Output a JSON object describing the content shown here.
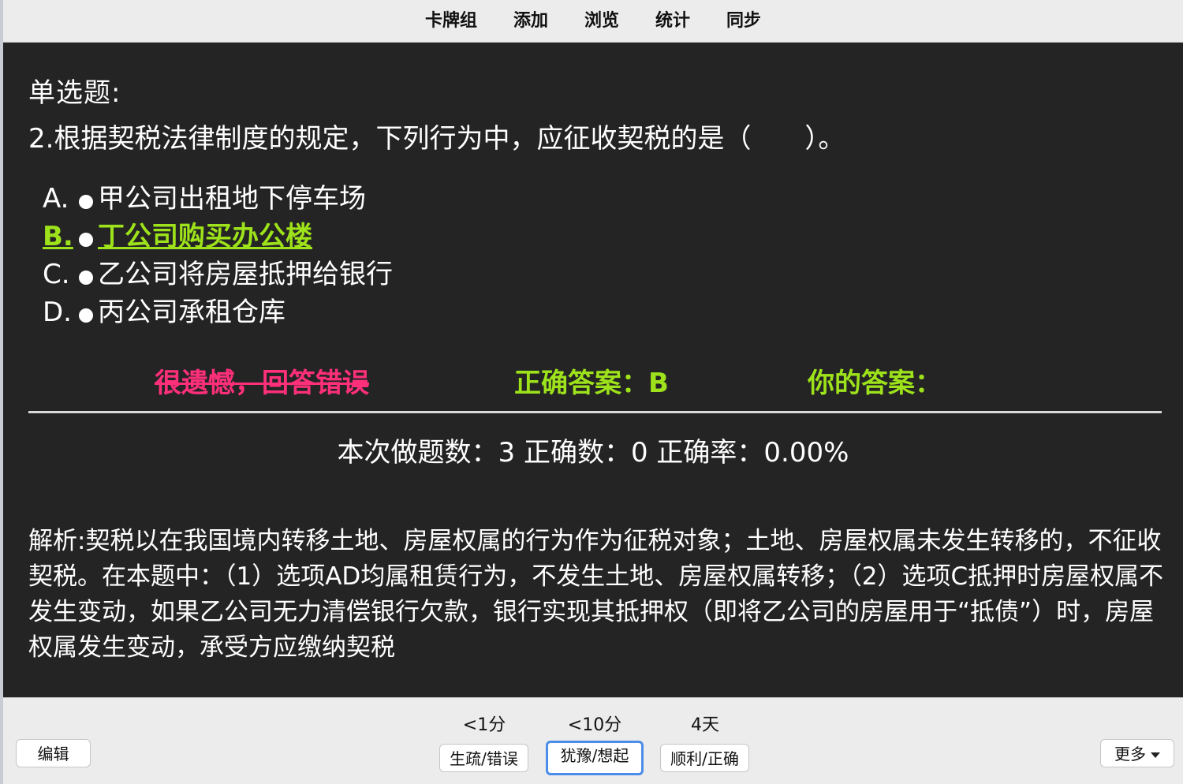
{
  "nav": {
    "items": [
      "卡牌组",
      "添加",
      "浏览",
      "统计",
      "同步"
    ]
  },
  "card": {
    "question_type": "单选题:",
    "question": "2.根据契税法律制度的规定，下列行为中，应征收契税的是（　　）。",
    "options": [
      {
        "letter": "A.",
        "text": "甲公司出租地下停车场"
      },
      {
        "letter": "B.",
        "text": "丁公司购买办公楼"
      },
      {
        "letter": "C.",
        "text": "乙公司将房屋抵押给银行"
      },
      {
        "letter": "D.",
        "text": "丙公司承租仓库"
      }
    ],
    "result_wrong": "很遗憾，回答错误",
    "correct_answer": "正确答案：B",
    "your_answer": "你的答案：",
    "stats": "本次做题数：3 正确数：0 正确率：0.00%",
    "analysis": "解析:契税以在我国境内转移土地、房屋权属的行为作为征税对象；土地、房屋权属未发生转移的，不征收契税。在本题中：（1）选项AD均属租赁行为，不发生土地、房屋权属转移；（2）选项C抵押时房屋权属不发生变动，如果乙公司无力清偿银行欠款，银行实现其抵押权（即将乙公司的房屋用于“抵债”）时，房屋权属发生变动，承受方应缴纳契税",
    "colors": {
      "background": "#242424",
      "correct": "#9de21a",
      "wrong": "#ff2f7a"
    }
  },
  "bottom": {
    "edit_label": "编辑",
    "more_label": "更多",
    "answers": [
      {
        "timing": "<1分",
        "label": "生疏/错误"
      },
      {
        "timing": "<10分",
        "label": "犹豫/想起"
      },
      {
        "timing": "4天",
        "label": "顺利/正确"
      }
    ]
  }
}
